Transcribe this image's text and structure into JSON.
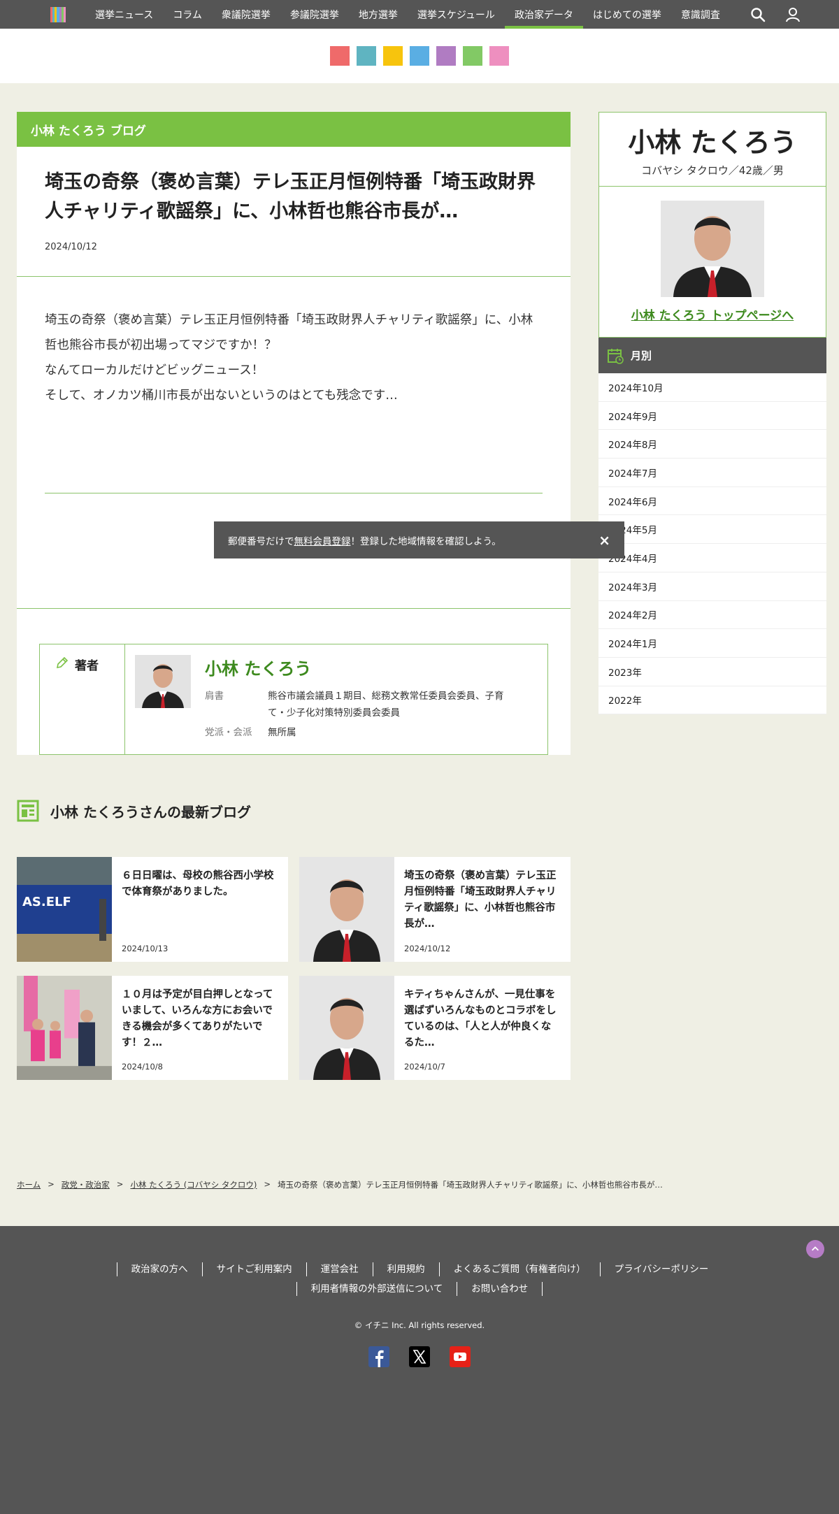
{
  "nav": {
    "items": [
      "選挙ニュース",
      "コラム",
      "衆議院選挙",
      "参議院選挙",
      "地方選挙",
      "選挙スケジュール",
      "政治家データ",
      "はじめての選挙",
      "意識調査"
    ],
    "active_index": 6
  },
  "colors": {
    "accent": "#7ac143",
    "dark": "#555555",
    "link_green": "#3d8a1e"
  },
  "color_squares": [
    "#ef6a6a",
    "#5fb4c1",
    "#f7c40d",
    "#5aaee3",
    "#b07cc2",
    "#82c965",
    "#ee8fbf"
  ],
  "blog": {
    "header": "小林 たくろう ブログ",
    "title": "埼玉の奇祭（褒め言葉）テレ玉正月恒例特番「埼玉政財界人チャリティ歌謡祭」に、小林哲也熊谷市長が…",
    "date": "2024/10/12",
    "body": [
      "埼玉の奇祭（褒め言葉）テレ玉正月恒例特番「埼玉政財界人チャリティ歌謡祭」に、小林哲也熊谷市長が初出場ってマジですか！？",
      "なんてローカルだけどビッグニュース！",
      "そして、オノカツ桶川市長が出ないというのはとても残念です…"
    ]
  },
  "author": {
    "label": "著者",
    "name": "小林 たくろう",
    "title_key": "肩書",
    "title_value": "熊谷市議会議員１期目、総務文教常任委員会委員、子育て・少子化対策特別委員会委員",
    "party_key": "党派・会派",
    "party_value": "無所属"
  },
  "latest": {
    "heading": "小林 たくろうさんの最新ブログ",
    "cards": [
      {
        "title": "６日日曜は、母校の熊谷西小学校で体育祭がありました。",
        "date": "2024/10/13"
      },
      {
        "title": "埼玉の奇祭（褒め言葉）テレ玉正月恒例特番「埼玉政財界人チャリティ歌謡祭」に、小林哲也熊谷市長が…",
        "date": "2024/10/12"
      },
      {
        "title": "１０月は予定が目白押しとなっていまして、いろんな方にお会いできる機会が多くてありがたいです！２…",
        "date": "2024/10/8"
      },
      {
        "title": "キティちゃんさんが、一見仕事を選ばずいろんなものとコラボをしているのは、「人と人が仲良くなるた…",
        "date": "2024/10/7"
      }
    ]
  },
  "breadcrumb": {
    "home": "ホーム",
    "parties": "政党・政治家",
    "person": "小林 たくろう (コバヤシ タクロウ)",
    "current": "埼玉の奇祭（褒め言葉）テレ玉正月恒例特番「埼玉政財界人チャリティ歌謡祭」に、小林哲也熊谷市長が…",
    "sep": ">"
  },
  "profile": {
    "name": "小林 たくろう",
    "kana": "コバヤシ タクロウ／42歳／男",
    "top_link": "小林 たくろう トップページへ"
  },
  "monthly": {
    "heading": "月別",
    "items": [
      "2024年10月",
      "2024年9月",
      "2024年8月",
      "2024年7月",
      "2024年6月",
      "2024年5月",
      "2024年4月",
      "2024年3月",
      "2024年2月",
      "2024年1月",
      "2023年",
      "2022年"
    ]
  },
  "toast": {
    "pre": "郵便番号だけで",
    "link": "無料会員登録",
    "post": "！登録した地域情報を確認しよう。",
    "close": "×"
  },
  "footer": {
    "links": [
      "政治家の方へ",
      "サイトご利用案内",
      "運営会社",
      "利用規約",
      "よくあるご質問（有権者向け）",
      "プライバシーポリシー",
      "利用者情報の外部送信について",
      "お問い合わせ"
    ],
    "copyright": "© イチニ Inc. All rights reserved."
  },
  "icons": {
    "search": "search-icon",
    "user": "user-icon",
    "pencil": "pencil-icon",
    "calendar": "calendar-icon",
    "blog": "blog-icon",
    "facebook": "facebook-icon",
    "x": "x-icon",
    "youtube": "youtube-icon",
    "pagetop": "chevron-up-icon"
  }
}
